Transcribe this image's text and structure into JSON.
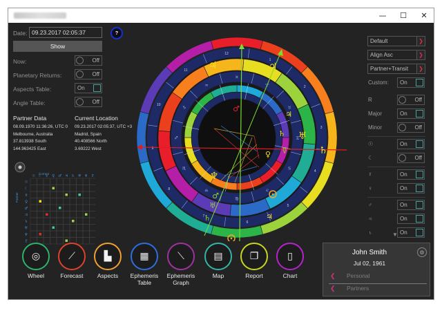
{
  "window": {
    "minimize_glyph": "—",
    "maximize_glyph": "☐",
    "close_glyph": "✕"
  },
  "left_panel": {
    "date_label": "Date:",
    "date_value": "09.23.2017 02:05:37",
    "help_label": "?",
    "show_button": "Show",
    "rows": [
      {
        "label": "Now:",
        "state": "Off"
      },
      {
        "label": "Planetary Returns:",
        "state": "Off"
      },
      {
        "label": "Aspects Table:",
        "state": "On"
      },
      {
        "label": "Angle Table:",
        "state": "Off"
      }
    ],
    "partner_data": {
      "title": "Partner Data",
      "lines": [
        "08.09.1970 11:36:26, UTC 0",
        "Melbourne, Australia",
        "37.813938 South",
        "144.963425 East"
      ]
    },
    "current_location": {
      "title": "Current Location",
      "lines": [
        "09.23.2017 02:05:37, UTC +3",
        "Madrid, Spain",
        "40.408566 North",
        "3.69222 West"
      ]
    },
    "aspect_grid": {
      "top_label": "Current",
      "side_label": "Partner",
      "mark_color": "#9ad14f"
    }
  },
  "right_panel": {
    "dropdowns": [
      {
        "label": "Default"
      },
      {
        "label": "Align Asc"
      },
      {
        "label": "Partner+Transit"
      }
    ],
    "custom_label": "Custom:",
    "custom_state": "On",
    "toggles": [
      {
        "label": "R",
        "state": "Off"
      },
      {
        "label": "Major",
        "state": "On"
      },
      {
        "label": "Minor",
        "state": "Off"
      },
      {
        "label": "☉",
        "state": "On"
      },
      {
        "label": "☾",
        "state": "Off"
      },
      {
        "label": "☿",
        "state": "On"
      },
      {
        "label": "♀",
        "state": "On"
      },
      {
        "label": "♂",
        "state": "On"
      },
      {
        "label": "♃",
        "state": "On"
      },
      {
        "label": "♄",
        "state": "On"
      }
    ]
  },
  "chart": {
    "outer_ring_colors": [
      "#e81f2a",
      "#ec3f1e",
      "#f77f1e",
      "#f7b51c",
      "#e7de21",
      "#9cd23b",
      "#2cb449",
      "#1fae95",
      "#1ea9d9",
      "#2b6ac6",
      "#5b3bb6",
      "#b51fa8"
    ],
    "accent_yellow": "#f3e21a",
    "accent_green": "#7bdd2e",
    "axis_color": "#e01b24",
    "planet_green": "#8fd62b",
    "planet_orange": "#f5a623",
    "planet_red": "#e0222d",
    "house_numbers": [
      "1",
      "2",
      "3",
      "4",
      "5",
      "6",
      "7",
      "8",
      "9",
      "10",
      "11",
      "12"
    ],
    "outer_glyphs": [
      "♈",
      "♉",
      "♊",
      "♋",
      "♌",
      "♍",
      "♎",
      "♏",
      "♐",
      "♑",
      "♒",
      "♓"
    ],
    "outer_planets": [
      "♃",
      "♃",
      "♄",
      "♅",
      "♆"
    ],
    "inner_planets": [
      "♂",
      "♃",
      "♄",
      "☿",
      "♀",
      "♅",
      "♄",
      "♃",
      "♂"
    ]
  },
  "bottom_nav": [
    {
      "label": "Wheel",
      "color": "#2db36b"
    },
    {
      "label": "Forecast",
      "color": "#e0412b"
    },
    {
      "label": "Aspects",
      "color": "#f0a031"
    },
    {
      "label": "Ephemeris Table",
      "color": "#2d6fe0"
    },
    {
      "label": "Ephemeris Graph",
      "color": "#a0329f"
    },
    {
      "label": "Map",
      "color": "#35b5a6"
    },
    {
      "label": "Report",
      "color": "#c9d61e"
    },
    {
      "label": "Chart",
      "color": "#b324c9"
    }
  ],
  "profile": {
    "name": "John Smith",
    "date": "Jul 02, 1961",
    "rows": [
      "Personal",
      "Partners"
    ],
    "collapse_glyph": "▼"
  }
}
